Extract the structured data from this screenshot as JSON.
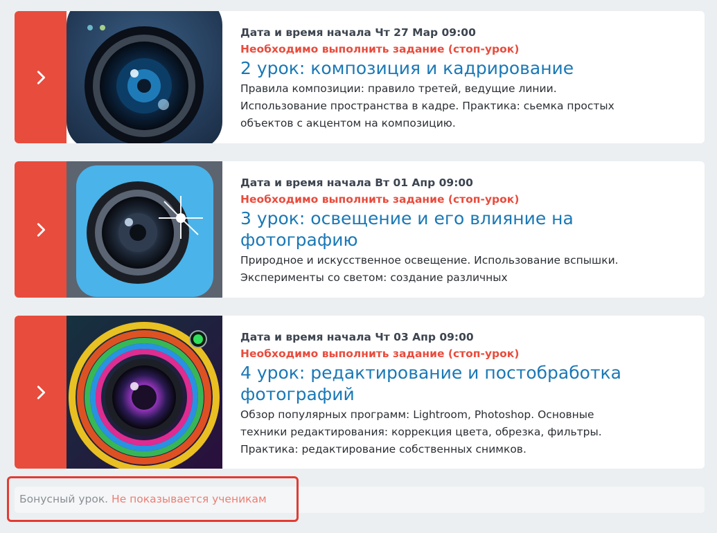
{
  "lessons": [
    {
      "start": "Дата и время начала Чт 27 Мар 09:00",
      "warning": "Необходимо выполнить задание (стоп-урок)",
      "title": "2 урок: композиция и кадрирование",
      "description": "Правила композиции: правило третей, ведущие линии. Использование пространства в кадре. Практика: сьемка простых объектов с акцентом на композицию.",
      "image_icon": "camera-lens-dark-icon"
    },
    {
      "start": "Дата и время начала Вт 01 Апр 09:00",
      "warning": "Необходимо выполнить задание (стоп-урок)",
      "title": "3 урок: освещение и его влияние на фотографию",
      "description": "Природное и искусственное освещение. Использование вспышки. Эксперименты со светом: создание различных",
      "image_icon": "camera-lens-blue-icon"
    },
    {
      "start": "Дата и время начала Чт 03 Апр 09:00",
      "warning": "Необходимо выполнить задание (стоп-урок)",
      "title": "4 урок: редактирование и постобработка фотографий",
      "description": "Обзор популярных программ: Lightroom, Photoshop. Основные техники редактирования: коррекция цвета, обрезка, фильтры. Практика: редактирование собственных снимков.",
      "image_icon": "camera-lens-rainbow-icon"
    }
  ],
  "bonus": {
    "label": "Бонусный урок.",
    "hidden_note": "Не показывается ученикам"
  },
  "colors": {
    "accent": "#e84c3d",
    "link": "#1a78b6",
    "highlight_border": "#e23b33"
  }
}
